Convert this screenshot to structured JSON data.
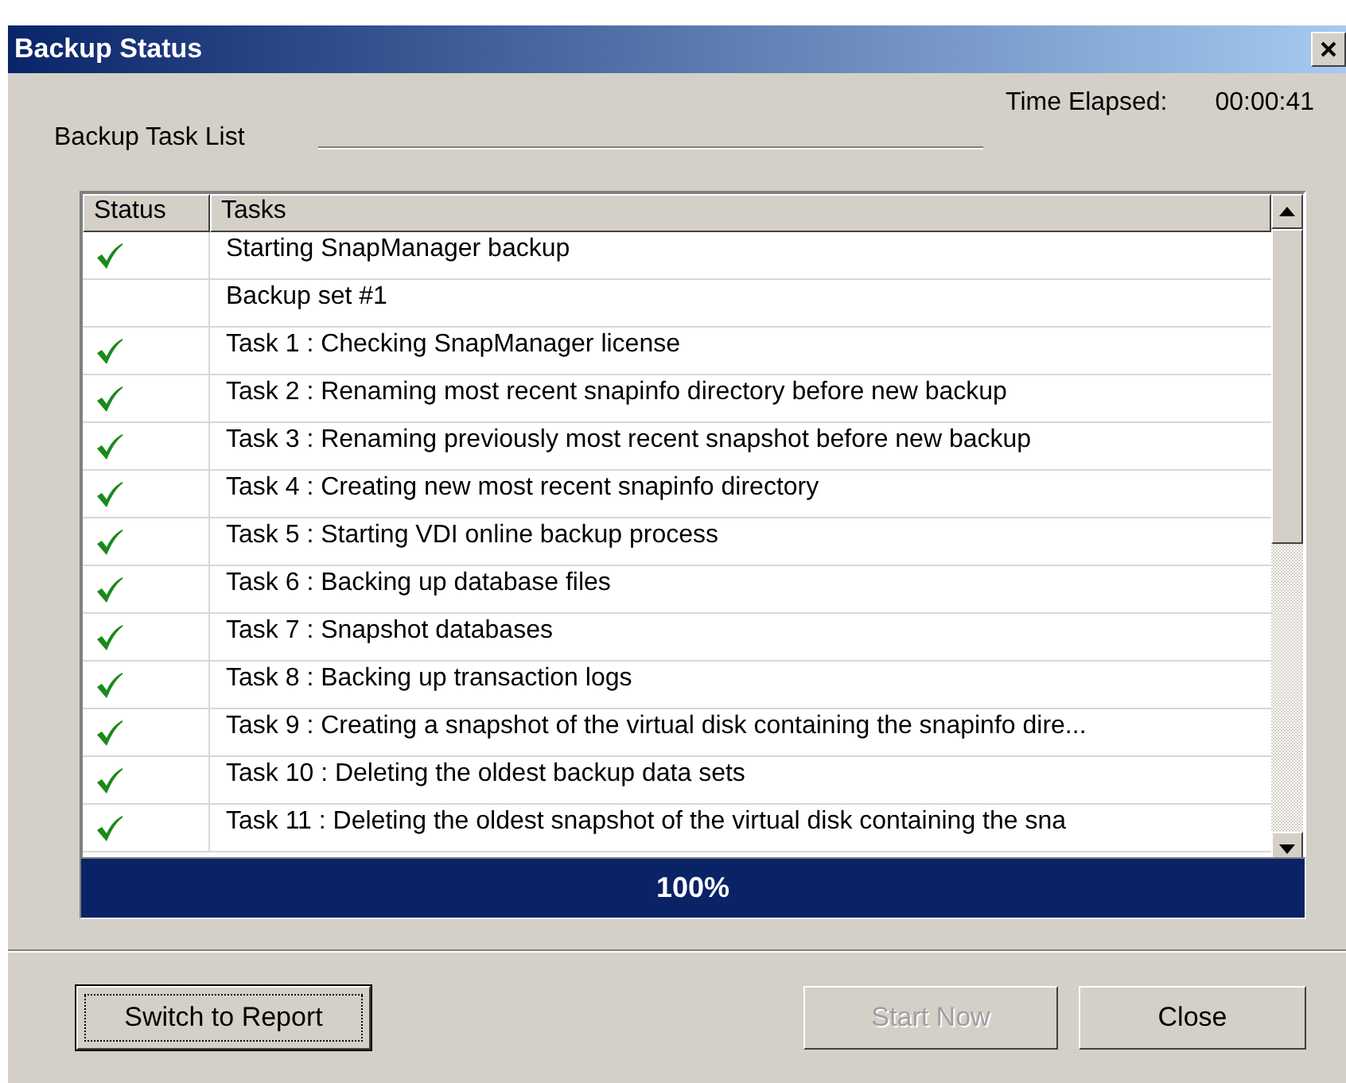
{
  "window": {
    "title": "Backup Status"
  },
  "group_label": "Backup Task List",
  "time_elapsed": {
    "label": "Time Elapsed:",
    "value": "00:00:41"
  },
  "table": {
    "columns": [
      "Status",
      "Tasks"
    ],
    "rows": [
      {
        "done": true,
        "task": "Starting SnapManager backup"
      },
      {
        "done": false,
        "task": "Backup set #1"
      },
      {
        "done": true,
        "task": "Task 1 : Checking SnapManager license"
      },
      {
        "done": true,
        "task": "Task 2 : Renaming most recent snapinfo directory before new backup"
      },
      {
        "done": true,
        "task": "Task 3 : Renaming previously most recent snapshot before new backup"
      },
      {
        "done": true,
        "task": "Task 4 : Creating new most recent snapinfo directory"
      },
      {
        "done": true,
        "task": "Task 5 : Starting VDI online backup process"
      },
      {
        "done": true,
        "task": "Task 6 : Backing up database files"
      },
      {
        "done": true,
        "task": "Task 7 : Snapshot databases"
      },
      {
        "done": true,
        "task": "Task 8 : Backing up transaction logs"
      },
      {
        "done": true,
        "task": "Task 9 : Creating a snapshot of the virtual disk containing the snapinfo dire..."
      },
      {
        "done": true,
        "task": "Task 10 : Deleting the oldest backup data sets"
      },
      {
        "done": true,
        "task": "Task 11 : Deleting the oldest snapshot of the virtual disk containing the sna"
      }
    ]
  },
  "progress": {
    "level": 1.0,
    "reading": "100%"
  },
  "buttons": [
    {
      "label": "Switch to Report",
      "disabled": false,
      "focused": true
    },
    {
      "label": "Start Now",
      "disabled": true,
      "focused": false
    },
    {
      "label": "Close",
      "disabled": false,
      "focused": false
    }
  ]
}
